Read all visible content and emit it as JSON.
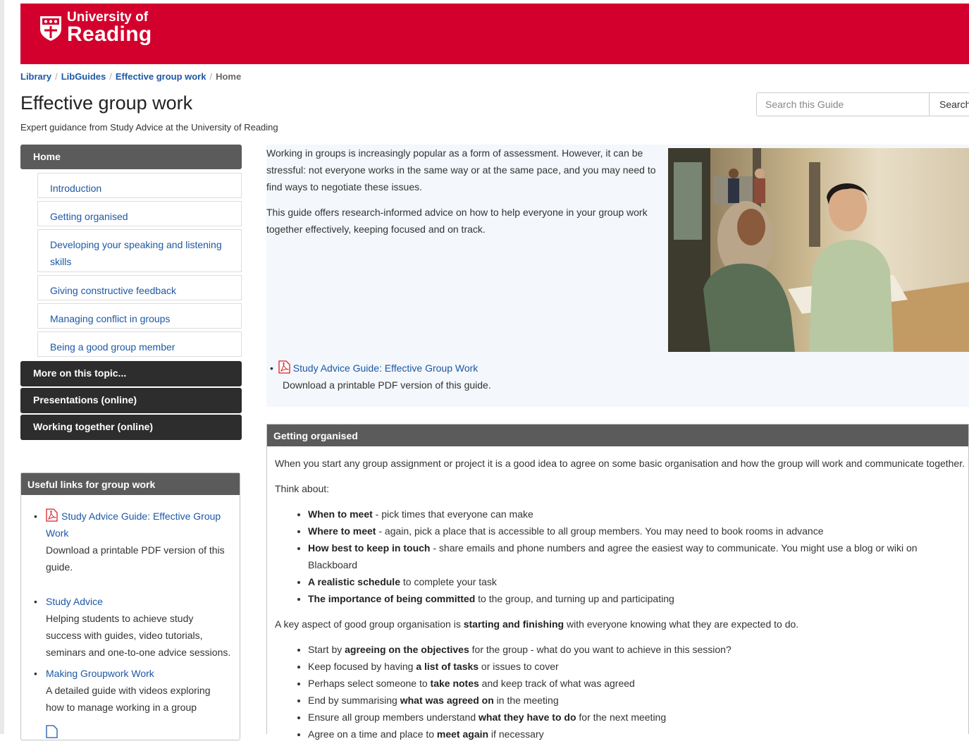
{
  "brand": {
    "name_line1": "University of",
    "name_line2": "Reading",
    "color": "#d3002d"
  },
  "breadcrumb": {
    "items": [
      "Library",
      "LibGuides",
      "Effective group work"
    ],
    "current": "Home",
    "separator": "/"
  },
  "page": {
    "title": "Effective group work",
    "subtitle": "Expert guidance from Study Advice at the University of Reading"
  },
  "search": {
    "placeholder": "Search this Guide",
    "button_label": "Search"
  },
  "nav": {
    "home": "Home",
    "subitems": [
      "Introduction",
      "Getting organised",
      "Developing your speaking and listening skills",
      "Giving constructive feedback",
      "Managing conflict in groups",
      "Being a good group member"
    ],
    "sections": [
      "More on this topic...",
      "Presentations (online)",
      "Working together (online)"
    ]
  },
  "useful_links": {
    "title": "Useful links for group work",
    "items": [
      {
        "link": "Study Advice Guide: Effective Group Work",
        "desc": "Download a printable PDF version of this guide.",
        "icon": "pdf-icon"
      },
      {
        "link": "Study Advice",
        "desc": "Helping students to achieve study success with guides, video tutorials, seminars and one-to-one advice sessions."
      },
      {
        "link": "Making Groupwork Work",
        "desc": "A detailed guide with videos exploring how to manage working in a group"
      }
    ]
  },
  "intro": {
    "paragraphs": [
      "Working in groups is increasingly popular as a form of assessment. However, it can be stressful: not everyone works in the same way or at the same pace, and you may need to find ways to negotiate these issues.",
      "This guide offers research-informed advice on how to help everyone in your group work together effectively, keeping focused and on track."
    ],
    "pdf_link": "Study Advice Guide: Effective Group Work",
    "pdf_desc": "Download a printable PDF version of this guide."
  },
  "organised": {
    "title": "Getting organised",
    "p1": "When you start any group assignment or project it is a good idea to agree on some basic organisation and how the group will work and communicate together.",
    "p2": "Think about:",
    "list1": [
      {
        "b": "When to meet",
        "t": " - pick times that everyone can make"
      },
      {
        "b": "Where to meet",
        "t": " - again, pick a place that is accessible to all group members. You may need to book rooms in advance"
      },
      {
        "b": "How best to keep in touch",
        "t": " - share emails and phone numbers and agree the easiest way to communicate. You might use a blog or wiki on Blackboard"
      },
      {
        "b": "A realistic schedule",
        "t": " to complete your task"
      },
      {
        "b": "The importance of being committed",
        "t": " to the group, and turning up and participating"
      }
    ],
    "p3_a": "A key aspect of good group organisation is ",
    "p3_b": "starting and finishing",
    "p3_c": " with everyone knowing what they are expected to do.",
    "list2": [
      {
        "a": "Start by ",
        "b": "agreeing on the objectives",
        "t": " for the group - what do you want to achieve in this session?"
      },
      {
        "a": "Keep focused by having ",
        "b": "a list of tasks",
        "t": " or issues to cover"
      },
      {
        "a": "Perhaps select someone to ",
        "b": "take notes",
        "t": " and keep track of what was agreed"
      },
      {
        "a": "End by summarising ",
        "b": "what was agreed on",
        "t": " in the meeting"
      },
      {
        "a": "Ensure all group members understand ",
        "b": "what they have to do",
        "t": " for the next meeting"
      },
      {
        "a": "Agree on a time and place to ",
        "b": "meet again",
        "t": " if necessary"
      }
    ]
  }
}
